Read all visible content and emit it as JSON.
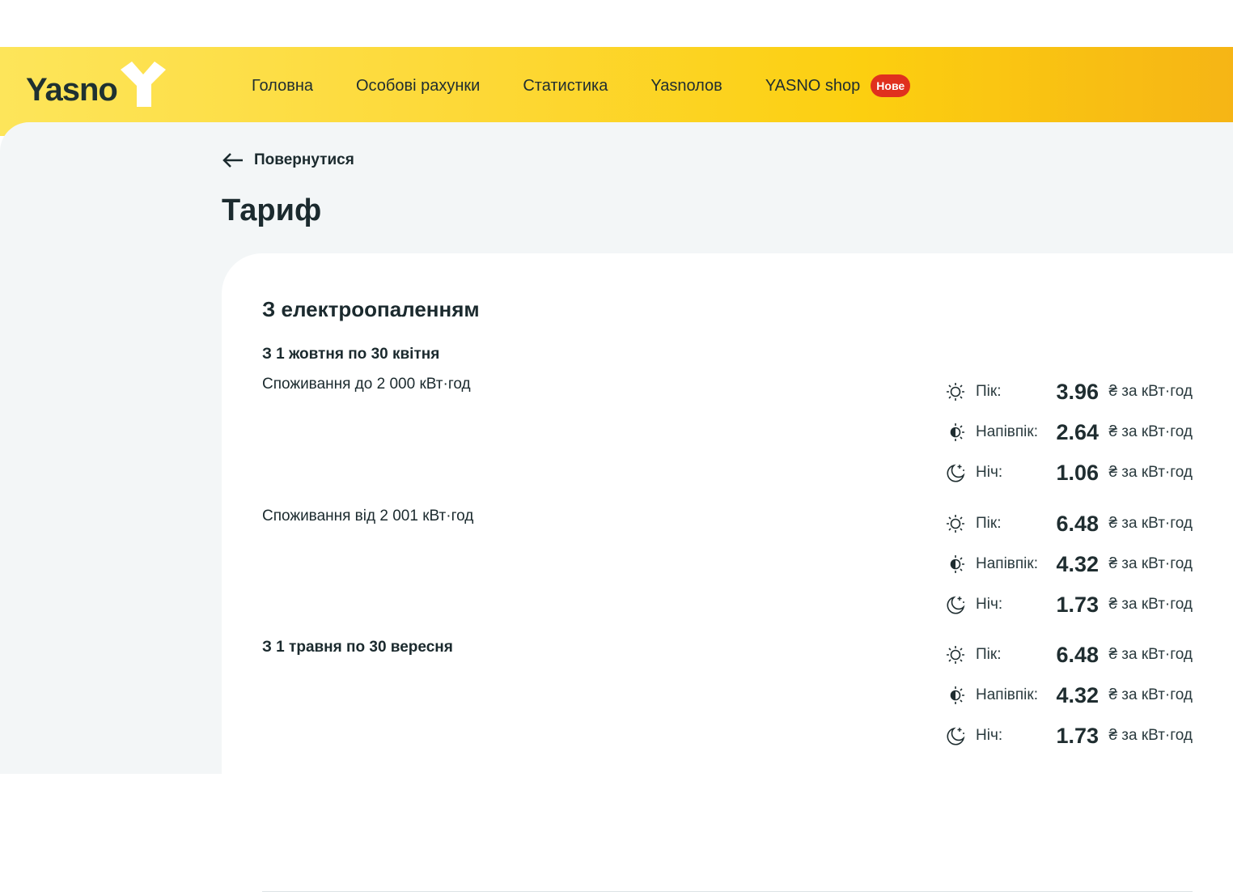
{
  "header": {
    "logo": "Yasno",
    "nav": [
      "Головна",
      "Особові рахунки",
      "Статистика",
      "Yasnолов",
      "YASNO shop"
    ],
    "badge": "Нове"
  },
  "back_label": "Повернутися",
  "page_title": "Тариф",
  "card": {
    "title": "З електроопаленням",
    "sections": [
      {
        "period": "З 1 жовтня по 30 квітня",
        "tiers": [
          {
            "label": "Споживання до 2 000 кВт·год",
            "rates": [
              {
                "name": "Пік:",
                "value": "3.96",
                "unit": "₴ за кВт·год",
                "icon": "sun-icon"
              },
              {
                "name": "Напівпік:",
                "value": "2.64",
                "unit": "₴ за кВт·год",
                "icon": "half-sun-icon"
              },
              {
                "name": "Ніч:",
                "value": "1.06",
                "unit": "₴ за кВт·год",
                "icon": "moon-icon"
              }
            ]
          },
          {
            "label": "Споживання від 2 001 кВт·год",
            "rates": [
              {
                "name": "Пік:",
                "value": "6.48",
                "unit": "₴ за кВт·год",
                "icon": "sun-icon"
              },
              {
                "name": "Напівпік:",
                "value": "4.32",
                "unit": "₴ за кВт·год",
                "icon": "half-sun-icon"
              },
              {
                "name": "Ніч:",
                "value": "1.73",
                "unit": "₴ за кВт·год",
                "icon": "moon-icon"
              }
            ]
          }
        ]
      },
      {
        "period": "З 1 травня по 30 вересня",
        "tiers": [
          {
            "rates": [
              {
                "name": "Пік:",
                "value": "6.48",
                "unit": "₴ за кВт·год",
                "icon": "sun-icon"
              },
              {
                "name": "Напівпік:",
                "value": "4.32",
                "unit": "₴ за кВт·год",
                "icon": "half-sun-icon"
              },
              {
                "name": "Ніч:",
                "value": "1.73",
                "unit": "₴ за кВт·год",
                "icon": "moon-icon"
              }
            ]
          }
        ]
      }
    ]
  }
}
